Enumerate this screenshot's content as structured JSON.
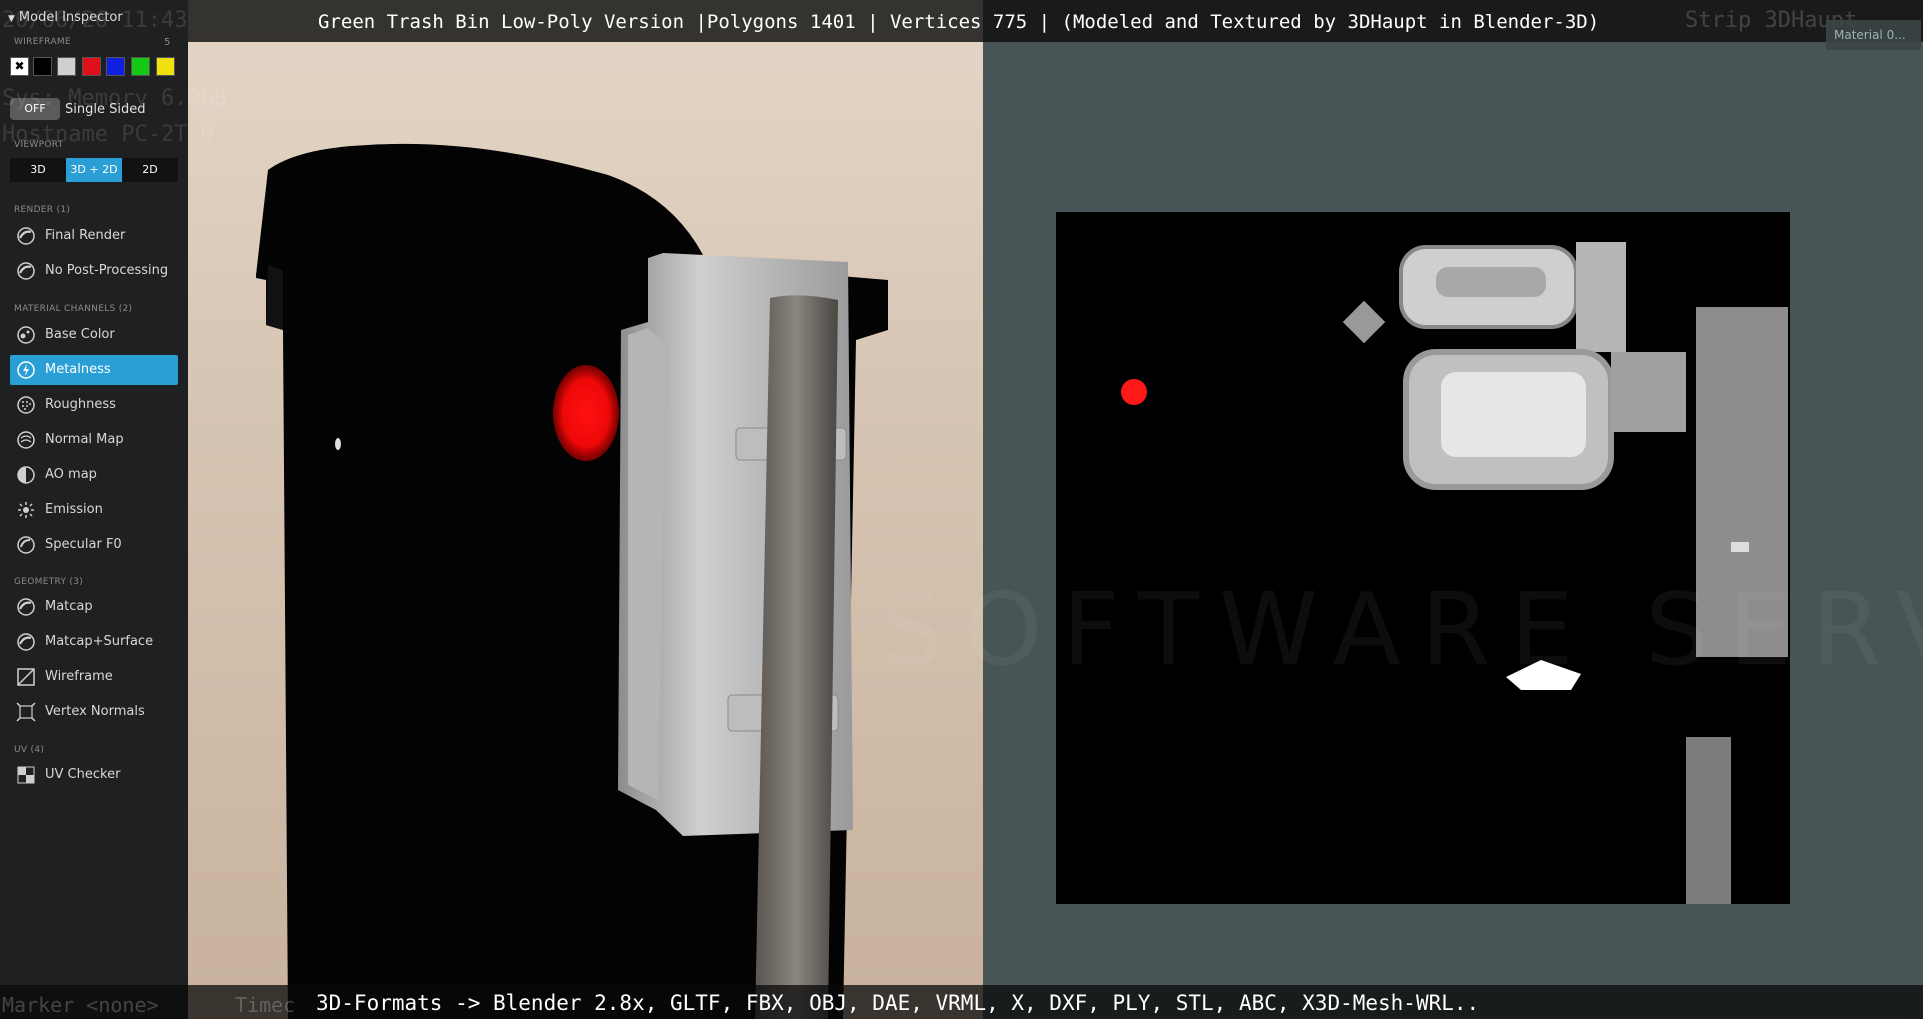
{
  "video_title": "Green Trash Bin Low-Poly Version |Polygons 1401 | Vertices 775 | (Modeled and Textured by 3DHaupt in Blender-3D)",
  "bottom_caption": "3D-Formats -> Blender 2.8x, GLTF, FBX, OBJ, DAE, VRML, X, DXF, PLY, STL, ABC, X3D-Mesh-WRL..",
  "ghost_overlay": {
    "timestamp": "20/06/26 11:43",
    "memory": "Sys: Memory 6.0GB",
    "hostname": "Hostname PC-2T-0",
    "strip": "Strip 3DHaupt",
    "marker": "Marker <none>",
    "timecode": "Timec"
  },
  "material_button": "Material 0...",
  "watermark": "SOFTWARE SERVICE JOHN",
  "inspector": {
    "title": "Model Inspector",
    "wireframe": {
      "label": "WIREFRAME",
      "count": "5",
      "swatches": [
        "#000000",
        "#cfcfcf",
        "#e0101a",
        "#1020e0",
        "#16c816",
        "#f0e010"
      ]
    },
    "single_sided": {
      "state": "OFF",
      "label": "Single Sided"
    },
    "viewport": {
      "label": "VIEWPORT",
      "options": [
        "3D",
        "3D + 2D",
        "2D"
      ],
      "selected": "3D + 2D"
    },
    "render": {
      "label": "RENDER (1)",
      "items": [
        "Final Render",
        "No Post-Processing"
      ]
    },
    "material_channels": {
      "label": "MATERIAL CHANNELS (2)",
      "items": [
        "Base Color",
        "Metalness",
        "Roughness",
        "Normal Map",
        "AO map",
        "Emission",
        "Specular F0"
      ],
      "selected": "Metalness"
    },
    "geometry": {
      "label": "GEOMETRY (3)",
      "items": [
        "Matcap",
        "Matcap+Surface",
        "Wireframe",
        "Vertex Normals"
      ]
    },
    "uv": {
      "label": "UV (4)",
      "items": [
        "UV Checker"
      ]
    }
  },
  "colors": {
    "accent": "#2a9fd6",
    "sidebar_bg": "#1f2021",
    "uv_bg": "#475556",
    "highlight_red": "#ff1010"
  }
}
